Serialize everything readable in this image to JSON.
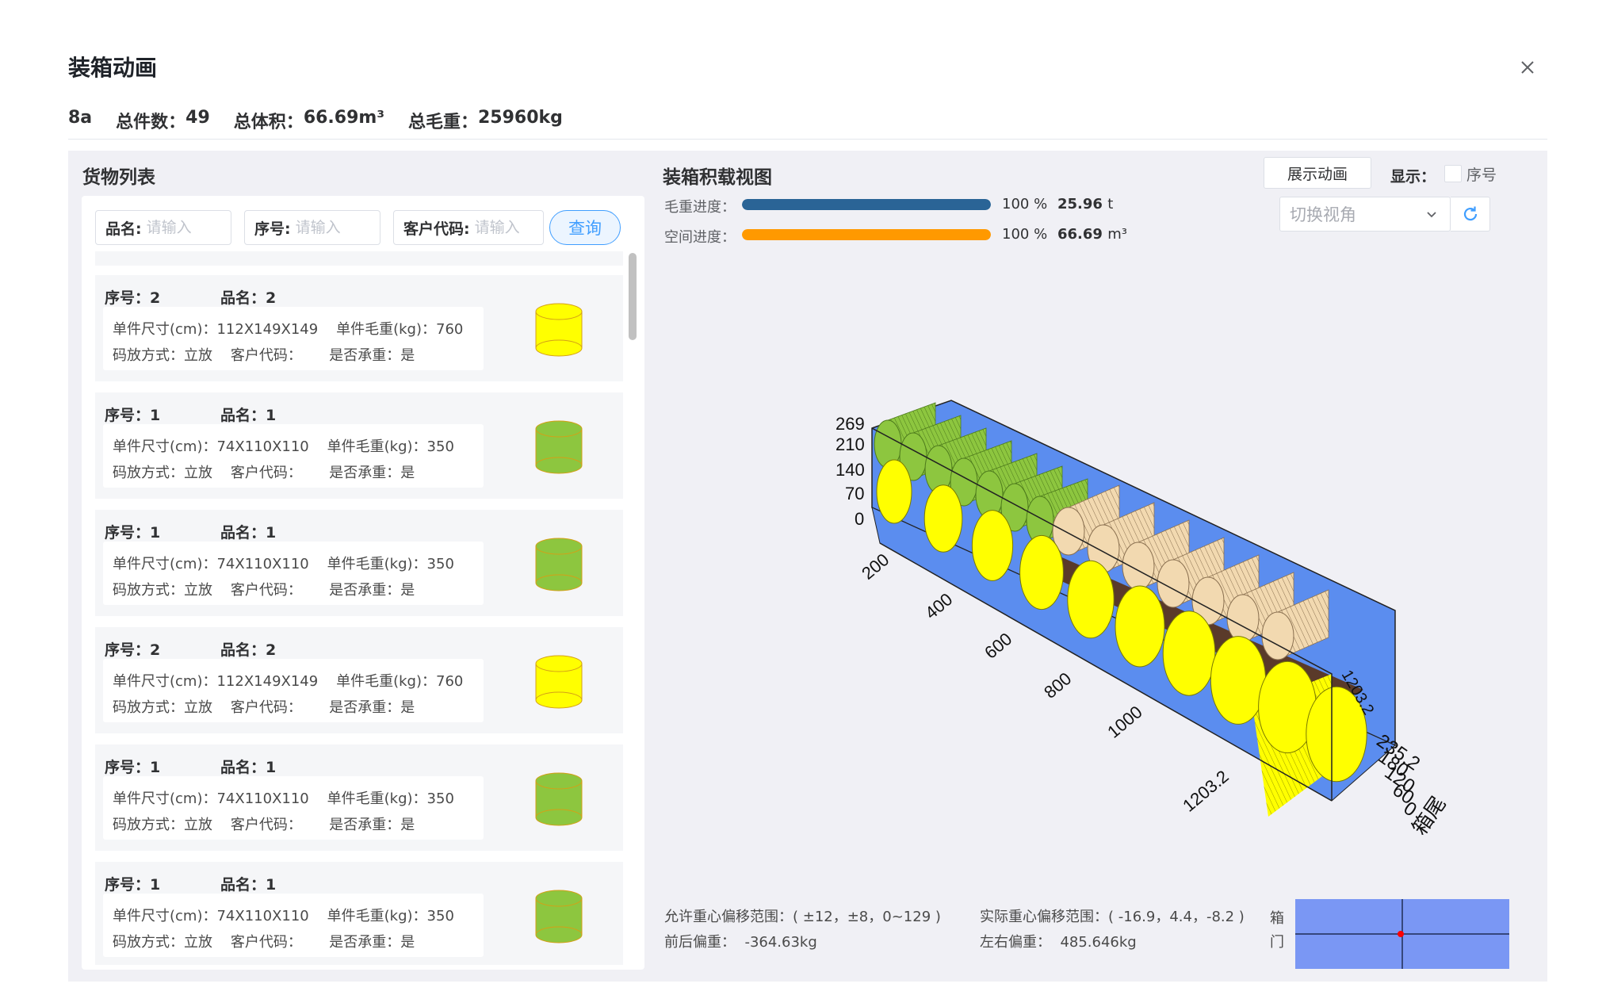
{
  "dialog": {
    "title": "装箱动画",
    "close_icon": "close-icon"
  },
  "summary": {
    "name": "8a",
    "count_label": "总件数：",
    "count": "49",
    "volume_label": "总体积：",
    "volume": "66.69m³",
    "weight_label": "总毛重：",
    "weight": "25960kg"
  },
  "goods": {
    "title": "货物列表",
    "filters": [
      {
        "label": "品名:",
        "placeholder": "请输入"
      },
      {
        "label": "序号:",
        "placeholder": "请输入"
      },
      {
        "label": "客户代码:",
        "placeholder": "请输入"
      }
    ],
    "query_label": "查询",
    "items": [
      {
        "seq_label": "序号：",
        "seq": "2",
        "name_label": "品名：",
        "name": "2",
        "size": "单件尺寸(cm)：112X149X149",
        "weight": "单件毛重(kg)：760",
        "stack": "码放方式：立放",
        "customer": "客户代码：",
        "bearing": "是否承重：是",
        "color": "#ffff00"
      },
      {
        "seq_label": "序号：",
        "seq": "1",
        "name_label": "品名：",
        "name": "1",
        "size": "单件尺寸(cm)：74X110X110",
        "weight": "单件毛重(kg)：350",
        "stack": "码放方式：立放",
        "customer": "客户代码：",
        "bearing": "是否承重：是",
        "color": "#8dc63f"
      },
      {
        "seq_label": "序号：",
        "seq": "1",
        "name_label": "品名：",
        "name": "1",
        "size": "单件尺寸(cm)：74X110X110",
        "weight": "单件毛重(kg)：350",
        "stack": "码放方式：立放",
        "customer": "客户代码：",
        "bearing": "是否承重：是",
        "color": "#8dc63f"
      },
      {
        "seq_label": "序号：",
        "seq": "2",
        "name_label": "品名：",
        "name": "2",
        "size": "单件尺寸(cm)：112X149X149",
        "weight": "单件毛重(kg)：760",
        "stack": "码放方式：立放",
        "customer": "客户代码：",
        "bearing": "是否承重：是",
        "color": "#ffff00"
      },
      {
        "seq_label": "序号：",
        "seq": "1",
        "name_label": "品名：",
        "name": "1",
        "size": "单件尺寸(cm)：74X110X110",
        "weight": "单件毛重(kg)：350",
        "stack": "码放方式：立放",
        "customer": "客户代码：",
        "bearing": "是否承重：是",
        "color": "#8dc63f"
      },
      {
        "seq_label": "序号：",
        "seq": "1",
        "name_label": "品名：",
        "name": "1",
        "size": "单件尺寸(cm)：74X110X110",
        "weight": "单件毛重(kg)：350",
        "stack": "码放方式：立放",
        "customer": "客户代码：",
        "bearing": "是否承重：是",
        "color": "#8dc63f"
      }
    ]
  },
  "view": {
    "title": "装箱积载视图",
    "animate_button": "展示动画",
    "show_label": "显示：",
    "seq_checkbox_label": "序号",
    "seq_checked": false,
    "view_select_placeholder": "切换视角",
    "refresh_icon": "refresh-icon",
    "weight_progress": {
      "label": "毛重进度：",
      "fraction": 1.0,
      "percent": "100",
      "pct_unit": "%",
      "value": "25.96",
      "unit": "t",
      "color": "#2a6496"
    },
    "space_progress": {
      "label": "空间进度：",
      "fraction": 1.0,
      "percent": "100",
      "pct_unit": "%",
      "value": "66.69",
      "unit": "m³",
      "color": "#ff9900"
    },
    "axes": {
      "height_ticks": [
        "269",
        "210",
        "140",
        "70",
        "0"
      ],
      "length_ticks": [
        "200",
        "400",
        "600",
        "800",
        "1000",
        "1203.2"
      ],
      "width_ticks": [
        "235.2",
        "180",
        "120",
        "60",
        "0"
      ],
      "end_length_label": "1203.2",
      "rear_label": "箱尾"
    },
    "container_color": "#5b8def",
    "cargo_colors": {
      "yellow": "#ffff00",
      "green": "#8dc63f",
      "wood": "#f2d9b0",
      "floor": "#5a3a2a"
    },
    "allowed_offset_label": "允许重心偏移范围：",
    "allowed_offset": "( ±12，±8，0~129 )",
    "actual_offset_label": "实际重心偏移范围：",
    "actual_offset": "( -16.9，4.4，-8.2 )",
    "front_back_label": "前后偏重：",
    "front_back_value": "-364.63kg",
    "left_right_label": "左右偏重：",
    "left_right_value": "485.646kg",
    "door_label": "箱门",
    "cog_box_color": "#7a97f4",
    "cog_point_color": "#ff0000"
  }
}
